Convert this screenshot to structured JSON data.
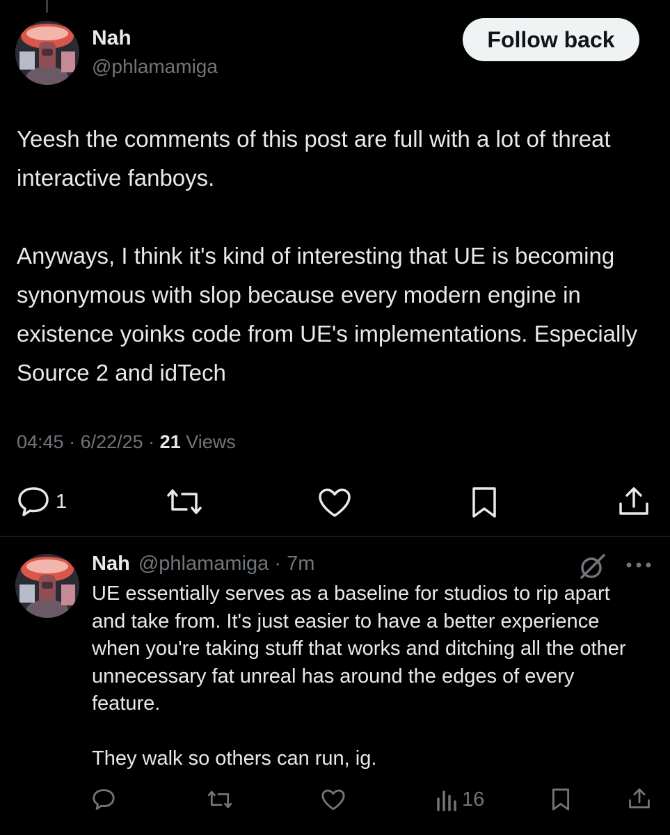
{
  "main_post": {
    "display_name": "Nah",
    "handle": "@phlamamiga",
    "follow_label": "Follow back",
    "text": "Yeesh the comments of this post are full with a lot of threat interactive fanboys.\n\nAnyways, I think it's kind of interesting that UE is becoming synonymous with slop because every modern engine in existence yoinks code from UE's implementations. Especially Source 2 and idTech",
    "time": "04:45",
    "date": "6/22/25",
    "views_count": "21",
    "views_label": "Views",
    "reply_count": "1"
  },
  "reply_post": {
    "display_name": "Nah",
    "handle": "@phlamamiga",
    "age": "7m",
    "text": "UE essentially serves as a baseline for studios to rip apart and take from. It's just easier to have a better experience when you're taking stuff that works and ditching all the other unnecessary fat unreal has around the edges of every feature.\n\nThey walk so others can run, ig.",
    "views_count": "16"
  },
  "icons": {
    "reply": "reply-icon",
    "repost": "repost-icon",
    "like": "heart-icon",
    "bookmark": "bookmark-icon",
    "share": "share-icon",
    "views": "views-icon",
    "grok": "grok-icon",
    "more": "more-icon"
  },
  "colors": {
    "background": "#000000",
    "text": "#e7e9ea",
    "secondary": "#71767b",
    "divider": "#2f3336",
    "button_bg": "#eff3f4"
  }
}
